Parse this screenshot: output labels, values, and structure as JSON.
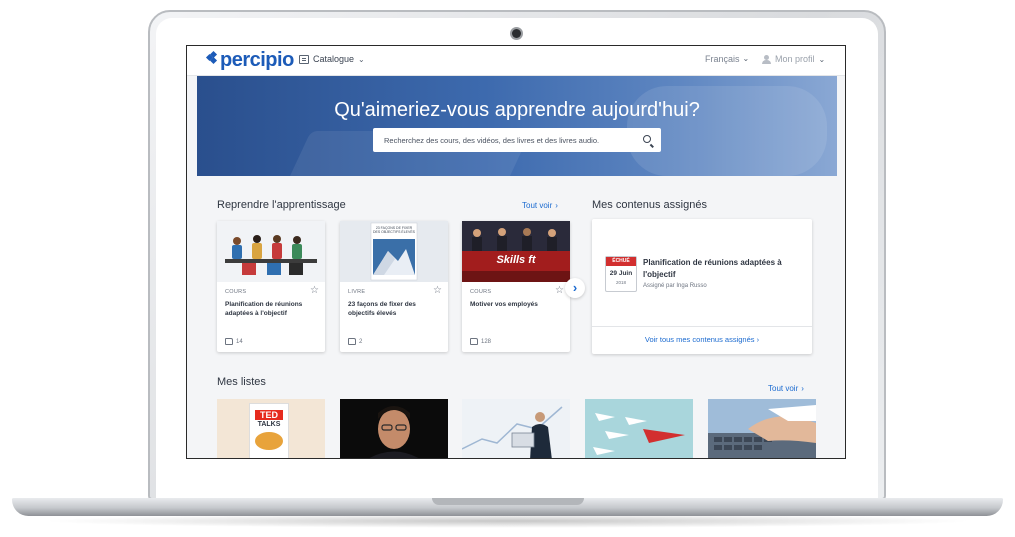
{
  "topbar": {
    "logo_text": "percipio",
    "catalogue_label": "Catalogue",
    "language_label": "Français",
    "profile_label": "Mon profil"
  },
  "hero": {
    "title": "Qu'aimeriez-vous apprendre aujourd'hui?",
    "search_placeholder": "Recherchez des cours, des vidéos, des livres et des livres audio."
  },
  "resume": {
    "title": "Reprendre l'apprentissage",
    "see_all": "Tout voir",
    "cards": [
      {
        "type": "COURS",
        "title": "Planification de réunions adaptées à l'objectif",
        "likes": "14"
      },
      {
        "type": "LIVRE",
        "title": "23 façons de fixer des objectifs élevés",
        "likes": "2"
      },
      {
        "type": "COURS",
        "title": "Motiver vos employés",
        "likes": "128"
      }
    ]
  },
  "assigned": {
    "title": "Mes contenus assignés",
    "badge_status": "ÉCHUÉ",
    "badge_day": "29 Juin",
    "badge_year": "2018",
    "item_title": "Planification de réunions adaptées à l'objectif",
    "assigned_by": "Assigné par Inga Russo",
    "see_all": "Voir tous mes contenus assignés"
  },
  "lists": {
    "title": "Mes listes",
    "see_all": "Tout voir",
    "ted_text": "TED",
    "ted_sub": "TALKS"
  },
  "book_cover_text": "23 FAÇONS DE FIXER DES OBJECTIFS ÉLEVÉS",
  "skills_text": "Skills ft",
  "colors": {
    "brand_blue": "#1c5bb8",
    "link_blue": "#1c6bd0",
    "overdue_red": "#d22f2f"
  }
}
